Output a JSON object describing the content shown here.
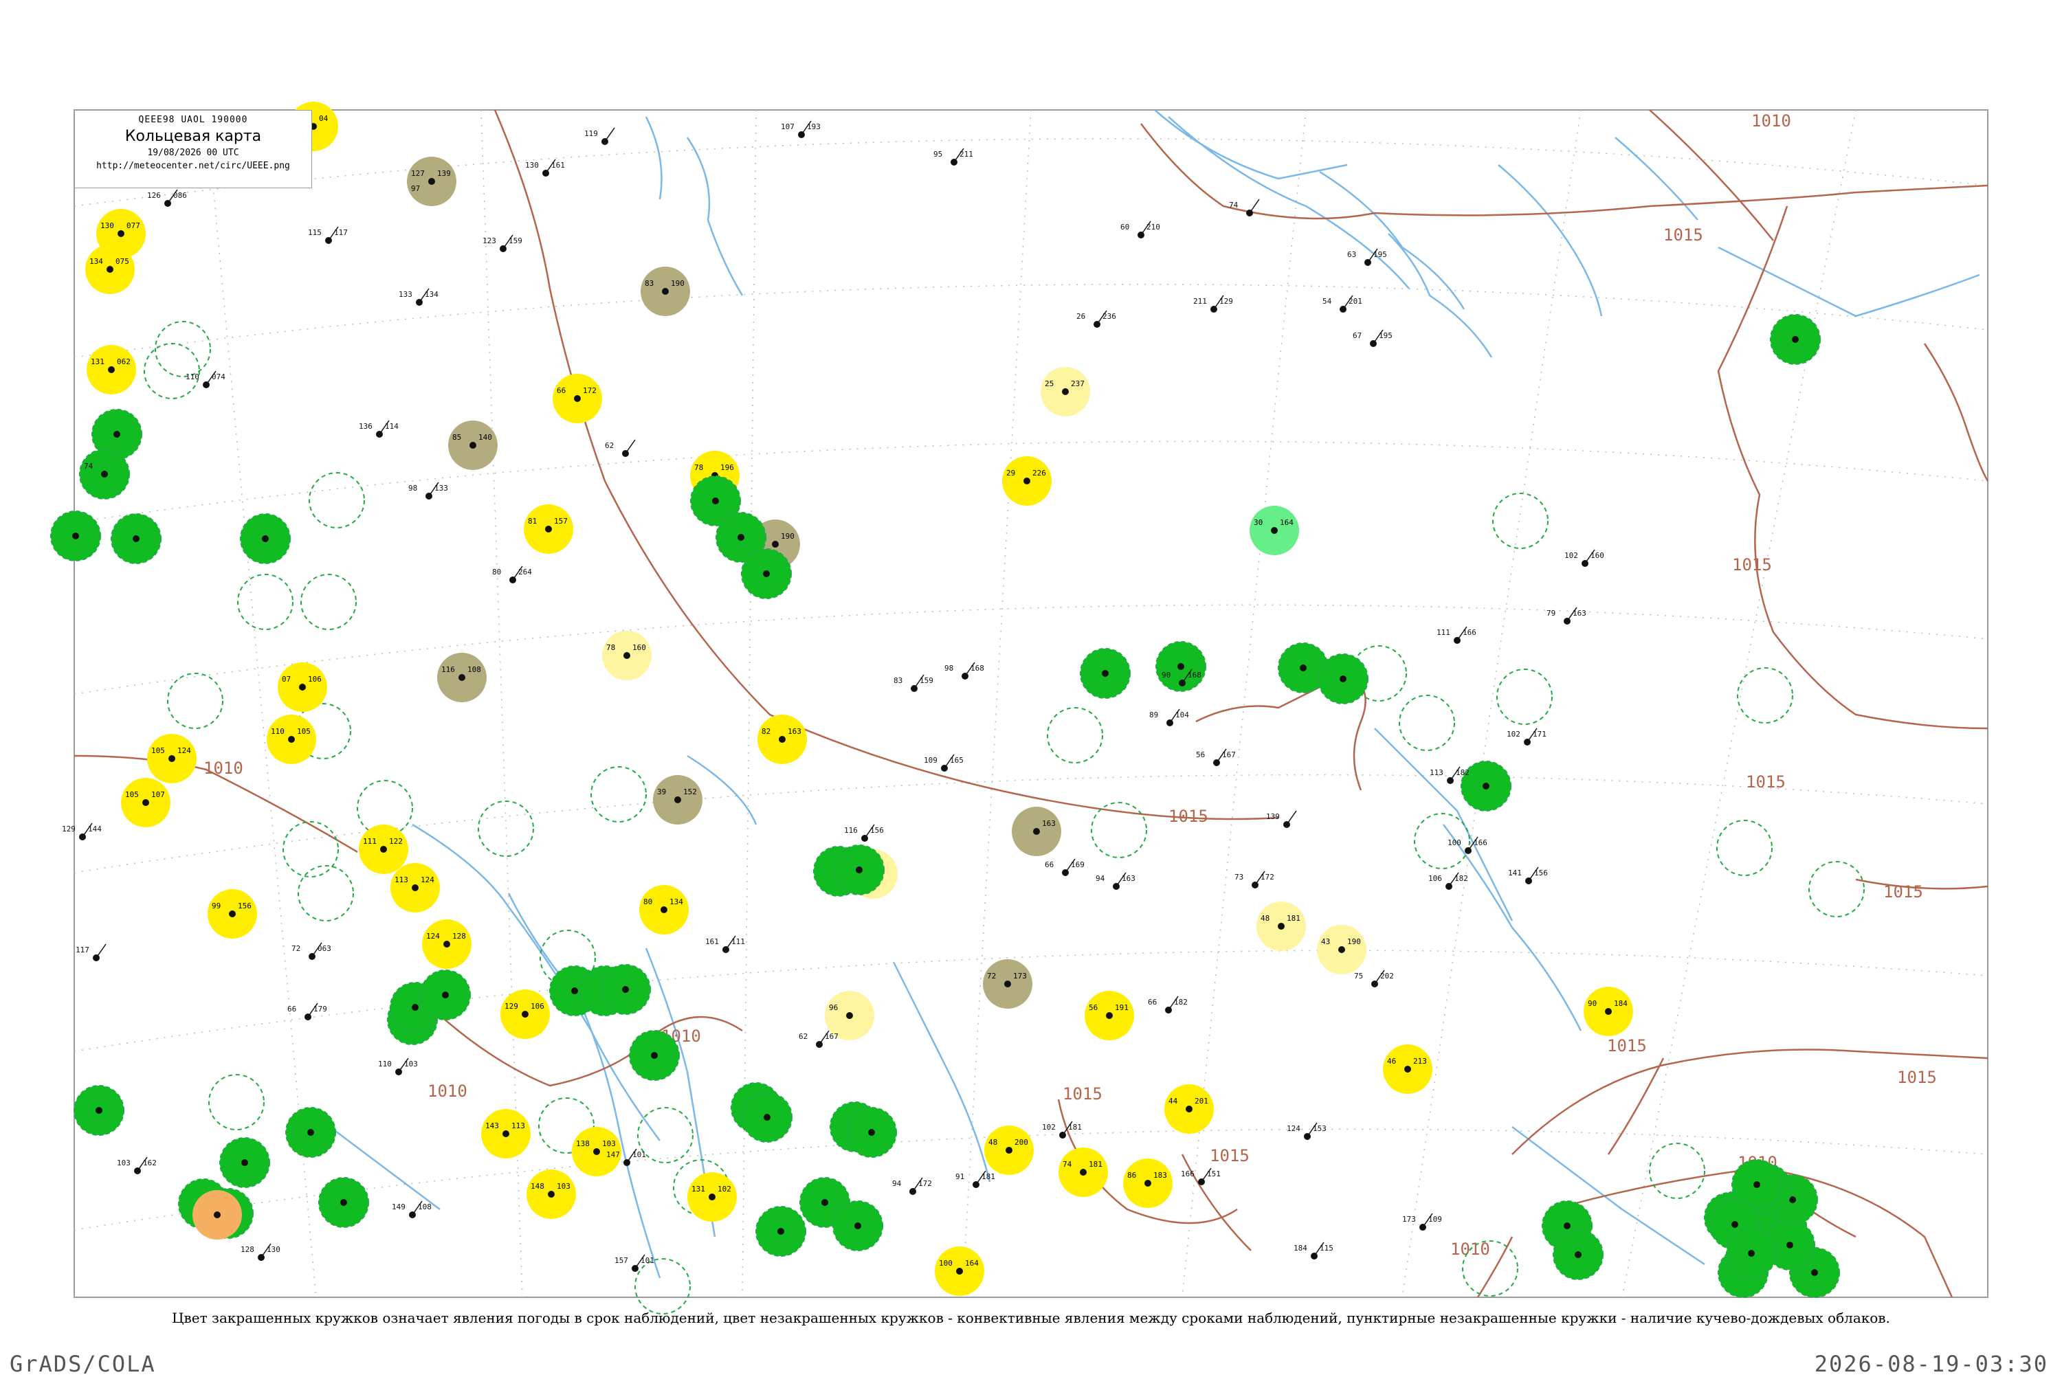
{
  "header": {
    "code_line": "QEEE98  UAOL  190000",
    "title": "Кольцевая карта",
    "date_line": "19/08/2026 00 UTC",
    "url": "http://meteocenter.net/circ/UEEE.png"
  },
  "caption": "Цвет закрашенных кружков означает явления погоды в срок наблюдений, цвет незакрашенных кружков - конвективные явления между сроками наблюдений, пунктирные незакрашенные кружки - наличие кучево-дождевых облаков.",
  "footer": {
    "left": "GrADS/COLA",
    "right": "2026-08-19-03:30"
  },
  "colors": {
    "green": "#11bb22",
    "light_green": "#66ee88",
    "yellow": "#ffee00",
    "pale_yellow": "#fff4a0",
    "olive": "#b3ac7f",
    "orange": "#f4b060",
    "river": "#7ab8e8",
    "isobar": "#b5654c",
    "ring": "#22aa44"
  },
  "isobar_labels": [
    {
      "text": "1010"
    },
    {
      "text": "1015"
    },
    {
      "text": "1015"
    },
    {
      "text": "1015"
    },
    {
      "text": "1015"
    },
    {
      "text": "1015"
    },
    {
      "text": "1015"
    },
    {
      "text": "1010"
    },
    {
      "text": "1010"
    },
    {
      "text": "1010"
    },
    {
      "text": "1015"
    },
    {
      "text": "1015"
    },
    {
      "text": "1015"
    },
    {
      "text": "1010"
    },
    {
      "text": "1010"
    }
  ],
  "stations": [
    {
      "fill": "olive",
      "t": "127",
      "p": "139",
      "d": "97"
    },
    {
      "fill": "yellow",
      "t": "122",
      "p": "04"
    },
    {
      "fill": "yellow",
      "t": "130",
      "p": "077"
    },
    {
      "fill": "yellow",
      "t": "134",
      "p": "075"
    },
    {
      "fill": "yellow",
      "t": "131",
      "p": "062"
    },
    {
      "fill": "olive",
      "t": "83",
      "p": "190"
    },
    {
      "fill": "olive",
      "t": "85",
      "p": "140"
    },
    {
      "fill": "yellow",
      "t": "66",
      "p": "172"
    },
    {
      "fill": "yellow",
      "t": "78",
      "p": "196"
    },
    {
      "fill": "olive",
      "t": "53",
      "p": "190"
    },
    {
      "fill": "yellow",
      "t": "81",
      "p": "157"
    },
    {
      "fill": "pale_yellow",
      "t": "78",
      "p": "160"
    },
    {
      "fill": "olive",
      "t": "116",
      "p": "108"
    },
    {
      "fill": "yellow",
      "t": "82",
      "p": "163"
    },
    {
      "fill": "olive",
      "t": "39",
      "p": "152"
    },
    {
      "fill": "yellow",
      "t": "29",
      "p": "226"
    },
    {
      "fill": "pale_yellow",
      "t": "25",
      "p": "237"
    },
    {
      "fill": "light_green",
      "t": "30",
      "p": "164"
    },
    {
      "fill": "green",
      "t": "",
      "p": ""
    },
    {
      "fill": "green",
      "t": "74",
      "p": ""
    },
    {
      "fill": "green",
      "t": "",
      "p": ""
    },
    {
      "fill": "green",
      "t": "",
      "p": ""
    },
    {
      "fill": "green",
      "t": "",
      "p": ""
    },
    {
      "fill": "green",
      "t": "",
      "p": ""
    },
    {
      "fill": "green",
      "t": "",
      "p": ""
    },
    {
      "fill": "green",
      "t": "",
      "p": ""
    },
    {
      "fill": "green",
      "t": "",
      "p": ""
    },
    {
      "fill": "green",
      "t": "",
      "p": ""
    },
    {
      "fill": "green",
      "t": "",
      "p": ""
    },
    {
      "fill": "yellow",
      "t": "07",
      "p": "106"
    },
    {
      "fill": "yellow",
      "t": "110",
      "p": "105"
    },
    {
      "fill": "yellow",
      "t": "105",
      "p": "124"
    },
    {
      "fill": "yellow",
      "t": "105",
      "p": "107"
    },
    {
      "fill": "yellow",
      "t": "111",
      "p": "122"
    },
    {
      "fill": "yellow",
      "t": "113",
      "p": "124"
    },
    {
      "fill": "yellow",
      "t": "99",
      "p": "156"
    },
    {
      "fill": "yellow",
      "t": "124",
      "p": "128"
    },
    {
      "fill": "yellow",
      "t": "129",
      "p": "106"
    },
    {
      "fill": "yellow",
      "t": "143",
      "p": "113"
    },
    {
      "fill": "yellow",
      "t": "138",
      "p": "103"
    },
    {
      "fill": "yellow",
      "t": "148",
      "p": "103"
    },
    {
      "fill": "yellow",
      "t": "131",
      "p": "102"
    },
    {
      "fill": "yellow",
      "t": "80",
      "p": "134"
    },
    {
      "fill": "pale_yellow",
      "t": "84",
      "p": ""
    },
    {
      "fill": "pale_yellow",
      "t": "96",
      "p": ""
    },
    {
      "fill": "olive",
      "t": "72",
      "p": "173"
    },
    {
      "fill": "olive",
      "t": "",
      "p": "163"
    },
    {
      "fill": "yellow",
      "t": "56",
      "p": "191"
    },
    {
      "fill": "yellow",
      "t": "44",
      "p": "201"
    },
    {
      "fill": "yellow",
      "t": "48",
      "p": "200"
    },
    {
      "fill": "yellow",
      "t": "86",
      "p": "183"
    },
    {
      "fill": "yellow",
      "t": "74",
      "p": "181"
    },
    {
      "fill": "yellow",
      "t": "100",
      "p": "164"
    },
    {
      "fill": "pale_yellow",
      "t": "48",
      "p": "181"
    },
    {
      "fill": "pale_yellow",
      "t": "43",
      "p": "190"
    },
    {
      "fill": "yellow",
      "t": "46",
      "p": "213"
    },
    {
      "fill": "yellow",
      "t": "90",
      "p": "184"
    },
    {
      "fill": "green",
      "t": "",
      "p": ""
    },
    {
      "fill": "green",
      "t": "",
      "p": ""
    },
    {
      "fill": "green",
      "t": "",
      "p": ""
    },
    {
      "fill": "green",
      "t": "",
      "p": ""
    },
    {
      "fill": "green",
      "t": "",
      "p": ""
    },
    {
      "fill": "green",
      "t": "",
      "p": ""
    },
    {
      "fill": "green",
      "t": "",
      "p": ""
    },
    {
      "fill": "green",
      "t": "",
      "p": ""
    },
    {
      "fill": "green",
      "t": "",
      "p": ""
    },
    {
      "fill": "green",
      "t": "",
      "p": ""
    },
    {
      "fill": "green",
      "t": "",
      "p": ""
    },
    {
      "fill": "green",
      "t": "",
      "p": ""
    },
    {
      "fill": "green",
      "t": "",
      "p": ""
    },
    {
      "fill": "green",
      "t": "",
      "p": ""
    },
    {
      "fill": "green",
      "t": "",
      "p": ""
    },
    {
      "fill": "green",
      "t": "",
      "p": ""
    },
    {
      "fill": "green",
      "t": "",
      "p": ""
    },
    {
      "fill": "green",
      "t": "",
      "p": ""
    },
    {
      "fill": "green",
      "t": "",
      "p": ""
    },
    {
      "fill": "green",
      "t": "",
      "p": ""
    },
    {
      "fill": "green",
      "t": "",
      "p": ""
    },
    {
      "fill": "green",
      "t": "",
      "p": ""
    },
    {
      "fill": "green",
      "t": "",
      "p": ""
    },
    {
      "fill": "green",
      "t": "",
      "p": ""
    },
    {
      "fill": "green",
      "t": "",
      "p": ""
    },
    {
      "fill": "green",
      "t": "",
      "p": ""
    },
    {
      "fill": "green",
      "t": "",
      "p": ""
    },
    {
      "fill": "green",
      "t": "",
      "p": ""
    },
    {
      "fill": "green",
      "t": "",
      "p": ""
    },
    {
      "fill": "orange",
      "t": "",
      "p": ""
    },
    {
      "fill": "green",
      "t": "",
      "p": ""
    },
    {
      "fill": "green",
      "t": "",
      "p": ""
    },
    {
      "fill": "green",
      "t": "",
      "p": ""
    },
    {
      "fill": "green",
      "t": "",
      "p": ""
    },
    {
      "fill": "green",
      "t": "",
      "p": ""
    },
    {
      "fill": "green",
      "t": "",
      "p": ""
    },
    {
      "fill": "green",
      "t": "",
      "p": ""
    },
    {
      "fill": "green",
      "t": "",
      "p": ""
    },
    {
      "fill": "green",
      "t": "",
      "p": ""
    }
  ],
  "rings": [
    {
      "style": "dash"
    },
    {
      "style": "dash"
    },
    {
      "style": "dash"
    },
    {
      "style": "dash"
    },
    {
      "style": "dash"
    },
    {
      "style": "dash"
    },
    {
      "style": "dash"
    },
    {
      "style": "dash"
    },
    {
      "style": "dash"
    },
    {
      "style": "dash"
    },
    {
      "style": "dash"
    },
    {
      "style": "dash"
    },
    {
      "style": "dash"
    },
    {
      "style": "dash"
    },
    {
      "style": "dash"
    },
    {
      "style": "dash"
    },
    {
      "style": "dash"
    },
    {
      "style": "dash"
    },
    {
      "style": "dash"
    },
    {
      "style": "dash"
    },
    {
      "style": "dash"
    },
    {
      "style": "dash"
    },
    {
      "style": "dash"
    },
    {
      "style": "dash"
    },
    {
      "style": "dash"
    },
    {
      "style": "dash"
    },
    {
      "style": "dash"
    },
    {
      "style": "dash"
    },
    {
      "style": "dash"
    },
    {
      "style": "dash"
    }
  ],
  "plain_stations": [
    {
      "t": "119",
      "p": ""
    },
    {
      "t": "130",
      "p": "161"
    },
    {
      "t": "107",
      "p": "193"
    },
    {
      "t": "95",
      "p": "211"
    },
    {
      "t": "126",
      "p": "086"
    },
    {
      "t": "115",
      "p": "117"
    },
    {
      "t": "123",
      "p": "159"
    },
    {
      "t": "133",
      "p": "134"
    },
    {
      "t": "60",
      "p": "210"
    },
    {
      "t": "74",
      "p": ""
    },
    {
      "t": "63",
      "p": "195"
    },
    {
      "t": "26",
      "p": "236"
    },
    {
      "t": "211",
      "p": "129"
    },
    {
      "t": "67",
      "p": "195"
    },
    {
      "t": "54",
      "p": "201"
    },
    {
      "t": "110",
      "p": "074"
    },
    {
      "t": "136",
      "p": "114"
    },
    {
      "t": "62",
      "p": ""
    },
    {
      "t": "98",
      "p": "133"
    },
    {
      "t": "80",
      "p": "264"
    },
    {
      "t": "90",
      "p": "168"
    },
    {
      "t": "83",
      "p": "159"
    },
    {
      "t": "98",
      "p": "168"
    },
    {
      "t": "89",
      "p": "104"
    },
    {
      "t": "109",
      "p": "165"
    },
    {
      "t": "102",
      "p": "160"
    },
    {
      "t": "79",
      "p": "163"
    },
    {
      "t": "111",
      "p": "166"
    },
    {
      "t": "102",
      "p": "171"
    },
    {
      "t": "113",
      "p": "182"
    },
    {
      "t": "56",
      "p": "167"
    },
    {
      "t": "66",
      "p": "169"
    },
    {
      "t": "94",
      "p": "163"
    },
    {
      "t": "73",
      "p": "172"
    },
    {
      "t": "139",
      "p": ""
    },
    {
      "t": "100",
      "p": "166"
    },
    {
      "t": "106",
      "p": "182"
    },
    {
      "t": "75",
      "p": "202"
    },
    {
      "t": "66",
      "p": "182"
    },
    {
      "t": "124",
      "p": "153"
    },
    {
      "t": "102",
      "p": "181"
    },
    {
      "t": "166",
      "p": "151"
    },
    {
      "t": "184",
      "p": "115"
    },
    {
      "t": "173",
      "p": "109"
    },
    {
      "t": "149",
      "p": "108"
    },
    {
      "t": "117",
      "p": ""
    },
    {
      "t": "72",
      "p": "063"
    },
    {
      "t": "66",
      "p": "179"
    },
    {
      "t": "91",
      "p": "181"
    },
    {
      "t": "94",
      "p": "172"
    },
    {
      "t": "116",
      "p": "156"
    },
    {
      "t": "141",
      "p": "156"
    },
    {
      "t": "103",
      "p": "162"
    },
    {
      "t": "128",
      "p": "130"
    },
    {
      "t": "110",
      "p": "103"
    },
    {
      "t": "161",
      "p": "111"
    },
    {
      "t": "147",
      "p": "101"
    },
    {
      "t": "157",
      "p": "101"
    },
    {
      "t": "129",
      "p": "144"
    },
    {
      "t": "62",
      "p": "167"
    }
  ]
}
